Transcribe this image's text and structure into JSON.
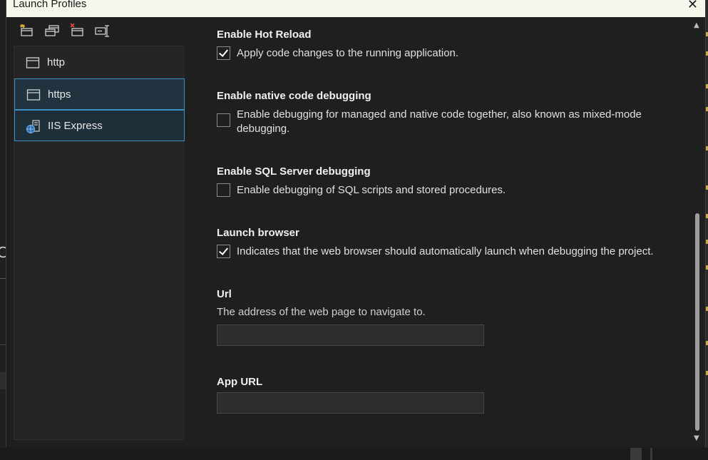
{
  "window": {
    "title": "Launch Profiles",
    "close_glyph": "✕"
  },
  "toolbar": {
    "buttons": [
      {
        "icon": "new-profile-icon"
      },
      {
        "icon": "copy-profile-icon"
      },
      {
        "icon": "delete-profile-icon"
      },
      {
        "icon": "rename-profile-icon"
      }
    ]
  },
  "profiles": [
    {
      "label": "http",
      "icon": "window-icon",
      "selected": false
    },
    {
      "label": "https",
      "icon": "window-icon",
      "selected": true
    },
    {
      "label": "IIS Express",
      "icon": "iis-express-icon",
      "selected": true
    }
  ],
  "settings": {
    "hot_reload": {
      "heading": "Enable Hot Reload",
      "label": "Apply code changes to the running application.",
      "checked": true
    },
    "native_debug": {
      "heading": "Enable native code debugging",
      "label_line1": "Enable debugging for managed and native code together, also known as mixed-mode",
      "label_line2": "debugging.",
      "checked": false
    },
    "sql_debug": {
      "heading": "Enable SQL Server debugging",
      "label": "Enable debugging of SQL scripts and stored procedures.",
      "checked": false
    },
    "launch_browser": {
      "heading": "Launch browser",
      "label": "Indicates that the web browser should automatically launch when debugging the project.",
      "checked": true
    },
    "url": {
      "heading": "Url",
      "description": "The address of the web page to navigate to.",
      "value": ""
    },
    "app_url": {
      "heading": "App URL",
      "value": ""
    }
  },
  "scrollbar": {
    "up": "▲",
    "down": "▼",
    "position": 0.85
  },
  "background": {
    "left_glyph": "C"
  }
}
